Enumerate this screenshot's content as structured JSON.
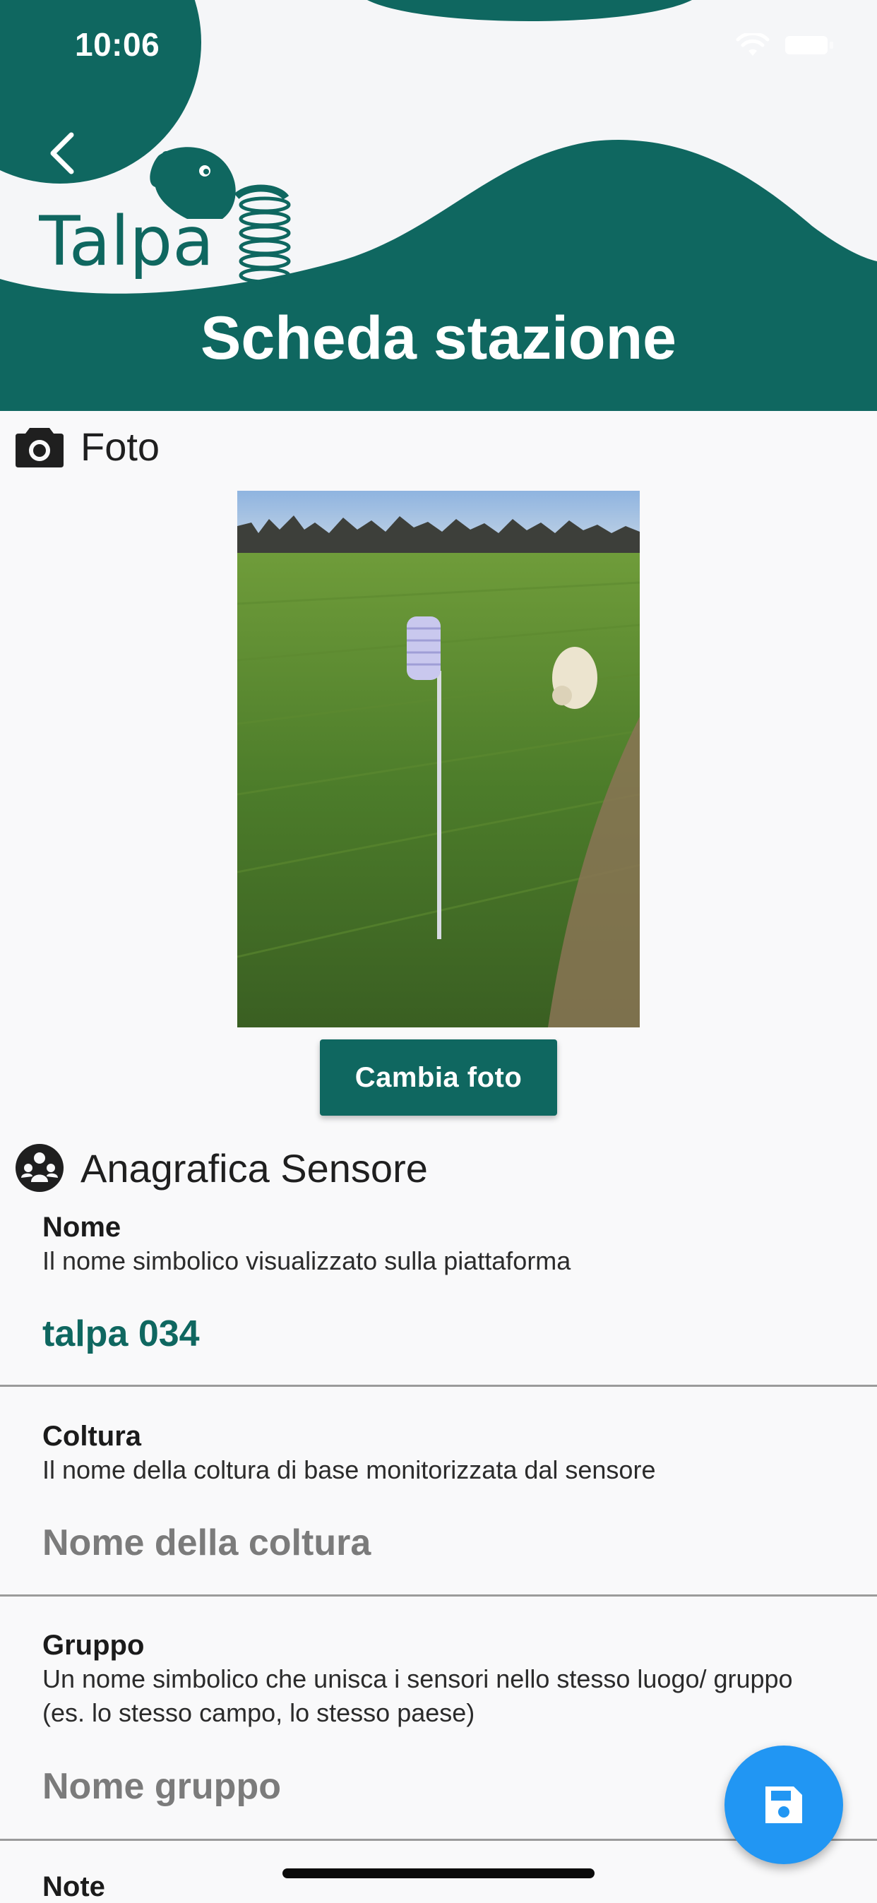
{
  "status_bar": {
    "time": "10:06"
  },
  "header": {
    "logo_text": "Talpa",
    "title": "Scheda stazione"
  },
  "photo_section": {
    "title": "Foto",
    "change_button": "Cambia foto"
  },
  "sensor_section": {
    "title": "Anagrafica Sensore",
    "fields": [
      {
        "label": "Nome",
        "description": "Il nome simbolico visualizzato sulla piattaforma",
        "value": "talpa 034",
        "placeholder": ""
      },
      {
        "label": "Coltura",
        "description": "Il nome della coltura di base monitorizzata dal sensore",
        "value": "",
        "placeholder": "Nome della coltura"
      },
      {
        "label": "Gruppo",
        "description": "Un nome simbolico che unisca i sensori nello stesso luogo/ gruppo (es. lo stesso campo, lo stesso paese)",
        "value": "",
        "placeholder": "Nome gruppo"
      },
      {
        "label": "Note"
      }
    ]
  },
  "colors": {
    "brand": "#0f6760",
    "fab": "#2196f3",
    "background": "#f9f9fa"
  },
  "icons": {
    "back": "chevron-left-icon",
    "photo": "camera-icon",
    "sensor": "group-icon",
    "save": "floppy-disk-icon"
  }
}
